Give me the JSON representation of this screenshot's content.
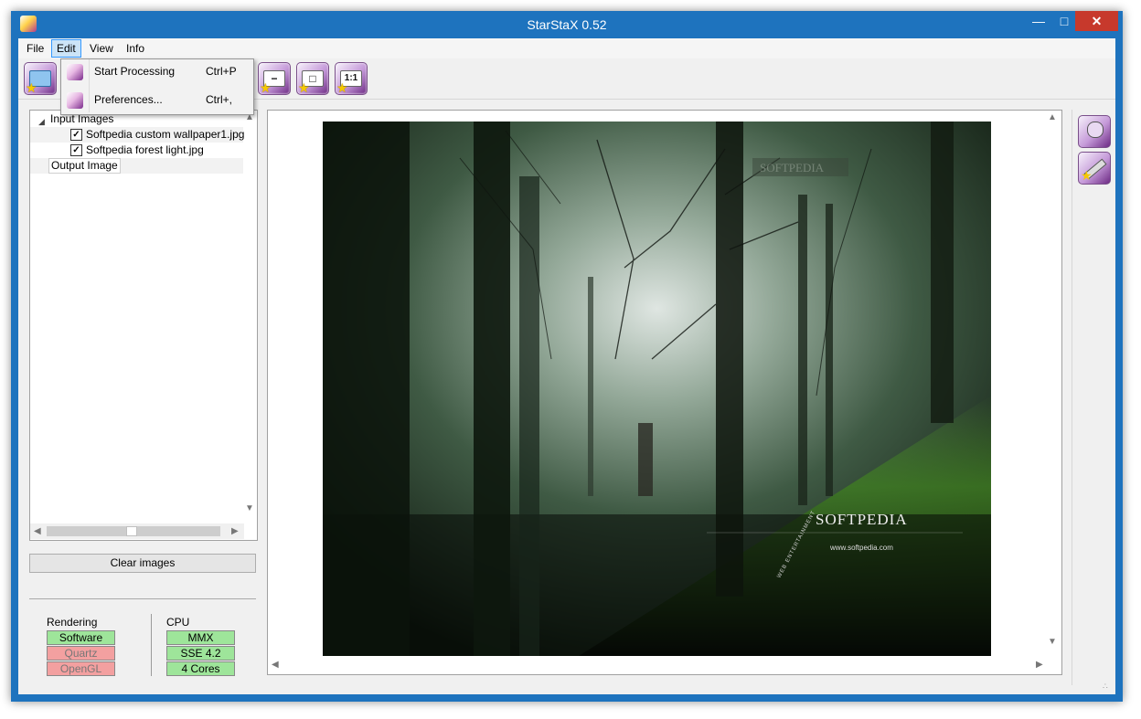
{
  "window": {
    "title": "StarStaX 0.52"
  },
  "menubar": [
    "File",
    "Edit",
    "View",
    "Info"
  ],
  "edit_menu": [
    {
      "label": "Start Processing",
      "shortcut": "Ctrl+P"
    },
    {
      "label": "Preferences...",
      "shortcut": "Ctrl+,"
    }
  ],
  "toolbar": {
    "buttons": [
      {
        "name": "open-images",
        "glyph": ""
      },
      {
        "name": "zoom-out",
        "glyph": "−"
      },
      {
        "name": "zoom-fit",
        "glyph": "□"
      },
      {
        "name": "zoom-actual",
        "glyph": "1:1"
      }
    ]
  },
  "tree": {
    "input_label": "Input Images",
    "files": [
      {
        "name": "Softpedia custom wallpaper1.jpg",
        "checked": true
      },
      {
        "name": "Softpedia forest light.jpg",
        "checked": true
      }
    ],
    "output_label": "Output Image"
  },
  "clear_button": "Clear images",
  "rendering": {
    "title": "Rendering",
    "items": [
      {
        "label": "Software",
        "status": "on"
      },
      {
        "label": "Quartz",
        "status": "off"
      },
      {
        "label": "OpenGL",
        "status": "off"
      }
    ]
  },
  "cpu": {
    "title": "CPU",
    "items": [
      {
        "label": "MMX",
        "status": "on"
      },
      {
        "label": "SSE 4.2",
        "status": "on"
      },
      {
        "label": "4 Cores",
        "status": "on"
      }
    ]
  },
  "preview": {
    "watermark_top": "SOFTPEDIA",
    "brand": "SOFTPEDIA",
    "url": "www.softpedia.com",
    "tagline": "WEB ENTERTAINMENT"
  }
}
